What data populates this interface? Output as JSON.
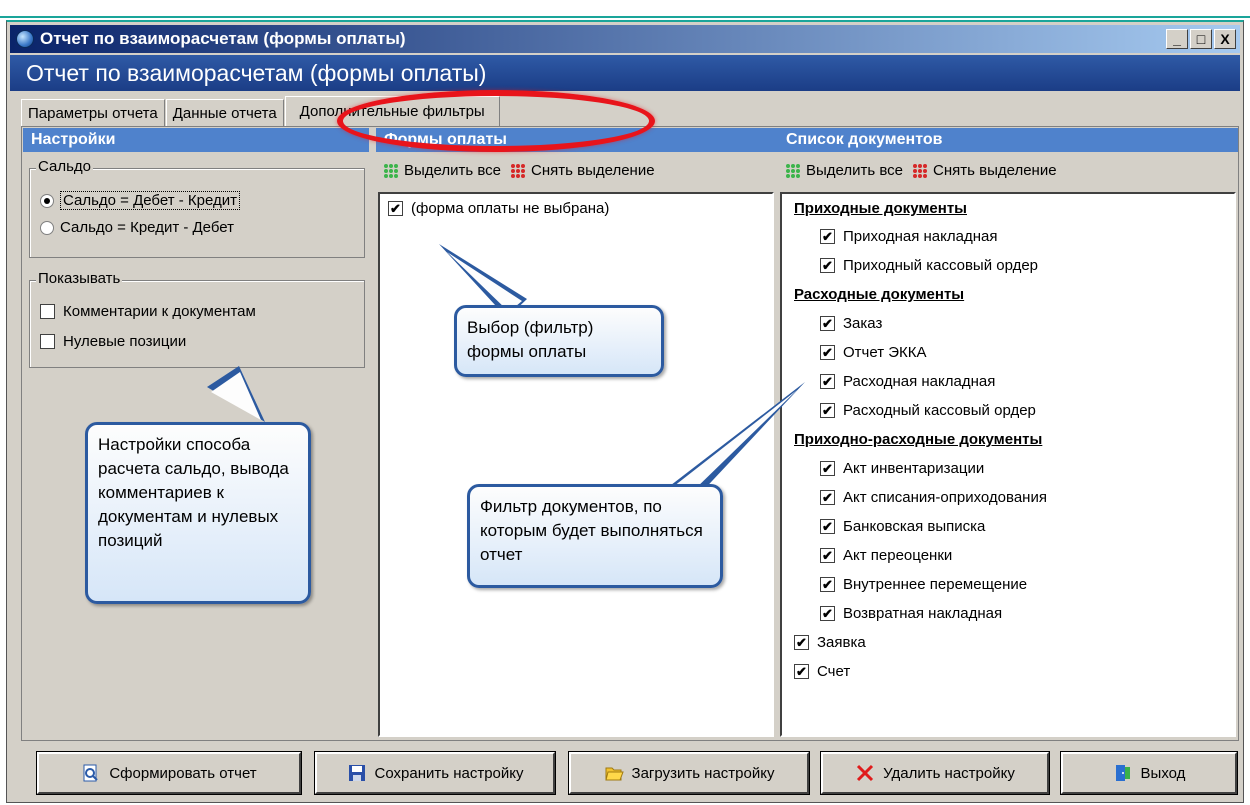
{
  "window": {
    "title": "Отчет по взаиморасчетам (формы оплаты)",
    "btn_min": "_",
    "btn_max": "□",
    "btn_close": "X"
  },
  "header": {
    "title": "Отчет по взаиморасчетам (формы оплаты)"
  },
  "tabs": [
    {
      "label": "Параметры отчета"
    },
    {
      "label": "Данные отчета"
    },
    {
      "label": "Дополнительные фильтры"
    }
  ],
  "settings": {
    "title": "Настройки",
    "saldo": {
      "legend": "Сальдо",
      "opt1": "Сальдо = Дебет - Кредит",
      "opt2": "Сальдо = Кредит - Дебет"
    },
    "show": {
      "legend": "Показывать",
      "opt1": "Комментарии к документам",
      "opt2": "Нулевые позиции"
    }
  },
  "payment_forms": {
    "title": "Формы оплаты",
    "select_all": "Выделить все",
    "deselect": "Снять выделение",
    "items": [
      {
        "label": "(форма оплаты не выбрана)",
        "checked": true
      }
    ]
  },
  "documents": {
    "title": "Список документов",
    "select_all": "Выделить все",
    "deselect": "Снять выделение",
    "group1": "Приходные документы",
    "g1_items": [
      "Приходная накладная",
      "Приходный кассовый ордер"
    ],
    "group2": "Расходные документы",
    "g2_items": [
      "Заказ",
      "Отчет ЭККА",
      "Расходная накладная",
      "Расходный кассовый ордер"
    ],
    "group3": "Приходно-расходные документы",
    "g3_items": [
      "Акт инвентаризации",
      "Акт списания-оприходования",
      "Банковская выписка",
      "Акт переоценки",
      "Внутреннее перемещение",
      "Возвратная накладная"
    ],
    "other_items": [
      "Заявка",
      "Счет"
    ]
  },
  "callouts": {
    "settings": "Настройки способа расчета сальдо, вывода комментариев к документам и нулевых позиций",
    "payment": "Выбор (фильтр) формы оплаты",
    "docs": "Фильтр документов, по которым будет выполняться отчет"
  },
  "buttons": {
    "generate": "Сформировать отчет",
    "save": "Сохранить настройку",
    "load": "Загрузить настройку",
    "delete": "Удалить настройку",
    "exit": "Выход"
  },
  "check_mark": "✔",
  "colors": {
    "title_bar": "#0a246a",
    "header": "#1b3d86",
    "panel_header": "#4f82cc",
    "highlight": "#e8141b",
    "callout_border": "#2c5aa0"
  }
}
